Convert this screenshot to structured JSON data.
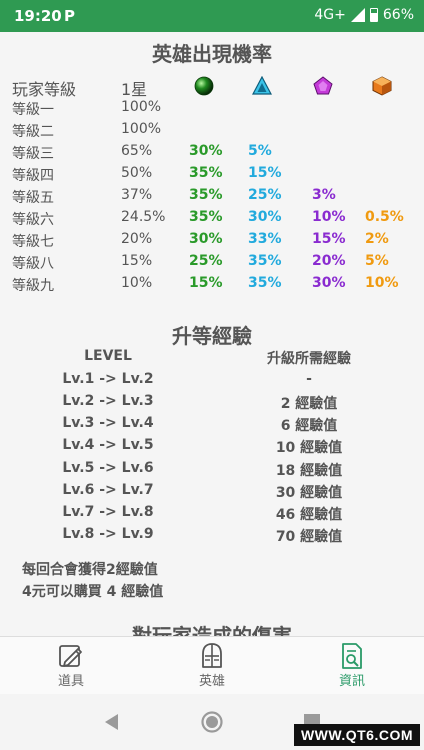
{
  "status_bar": {
    "time": "19:20",
    "app_badge": "P",
    "network": "4G+",
    "battery_percent": "66%"
  },
  "rates": {
    "title": "英雄出現機率",
    "header": {
      "label": "玩家等級",
      "star1": "1星"
    },
    "gems": [
      "green-orb-icon",
      "cyan-triangle-icon",
      "purple-pentagon-icon",
      "orange-cube-icon"
    ],
    "rows": [
      {
        "level": "等級一",
        "v1": "100%",
        "v2": "",
        "v3": "",
        "v4": "",
        "v5": ""
      },
      {
        "level": "等級二",
        "v1": "100%",
        "v2": "",
        "v3": "",
        "v4": "",
        "v5": ""
      },
      {
        "level": "等級三",
        "v1": "65%",
        "v2": "30%",
        "v3": "5%",
        "v4": "",
        "v5": ""
      },
      {
        "level": "等級四",
        "v1": "50%",
        "v2": "35%",
        "v3": "15%",
        "v4": "",
        "v5": ""
      },
      {
        "level": "等級五",
        "v1": "37%",
        "v2": "35%",
        "v3": "25%",
        "v4": "3%",
        "v5": ""
      },
      {
        "level": "等級六",
        "v1": "24.5%",
        "v2": "35%",
        "v3": "30%",
        "v4": "10%",
        "v5": "0.5%"
      },
      {
        "level": "等級七",
        "v1": "20%",
        "v2": "30%",
        "v3": "33%",
        "v4": "15%",
        "v5": "2%"
      },
      {
        "level": "等級八",
        "v1": "15%",
        "v2": "25%",
        "v3": "35%",
        "v4": "20%",
        "v5": "5%"
      },
      {
        "level": "等級九",
        "v1": "10%",
        "v2": "15%",
        "v3": "35%",
        "v4": "30%",
        "v5": "10%"
      }
    ],
    "colors": {
      "tier2": "#2a9a2a",
      "tier3": "#22aadd",
      "tier4": "#8a2bd0",
      "tier5": "#f09a10"
    }
  },
  "exp": {
    "title": "升等經驗",
    "col_level": "LEVEL",
    "col_exp": "升級所需經驗",
    "rows": [
      {
        "from_to": "Lv.1 -> Lv.2",
        "exp": "-"
      },
      {
        "from_to": "Lv.2 -> Lv.3",
        "exp": "2 經驗值"
      },
      {
        "from_to": "Lv.3 -> Lv.4",
        "exp": "6 經驗值"
      },
      {
        "from_to": "Lv.4 -> Lv.5",
        "exp": "10 經驗值"
      },
      {
        "from_to": "Lv.5 -> Lv.6",
        "exp": "18 經驗值"
      },
      {
        "from_to": "Lv.6 -> Lv.7",
        "exp": "30 經驗值"
      },
      {
        "from_to": "Lv.7 -> Lv.8",
        "exp": "46 經驗值"
      },
      {
        "from_to": "Lv.8 -> Lv.9",
        "exp": "70 經驗值"
      }
    ],
    "notes": [
      "每回合會獲得2經驗值",
      "4元可以購買 4 經驗值"
    ]
  },
  "next_section_title_partial": "對玩家造成的傷害",
  "bottom_nav": {
    "items": [
      {
        "label": "道具",
        "icon": "item-pen-icon",
        "active": false
      },
      {
        "label": "英雄",
        "icon": "hero-helmet-icon",
        "active": false
      },
      {
        "label": "資訊",
        "icon": "info-document-icon",
        "active": true
      }
    ],
    "active_color": "#2a9a68"
  },
  "watermark": "WWW.QT6.COM"
}
